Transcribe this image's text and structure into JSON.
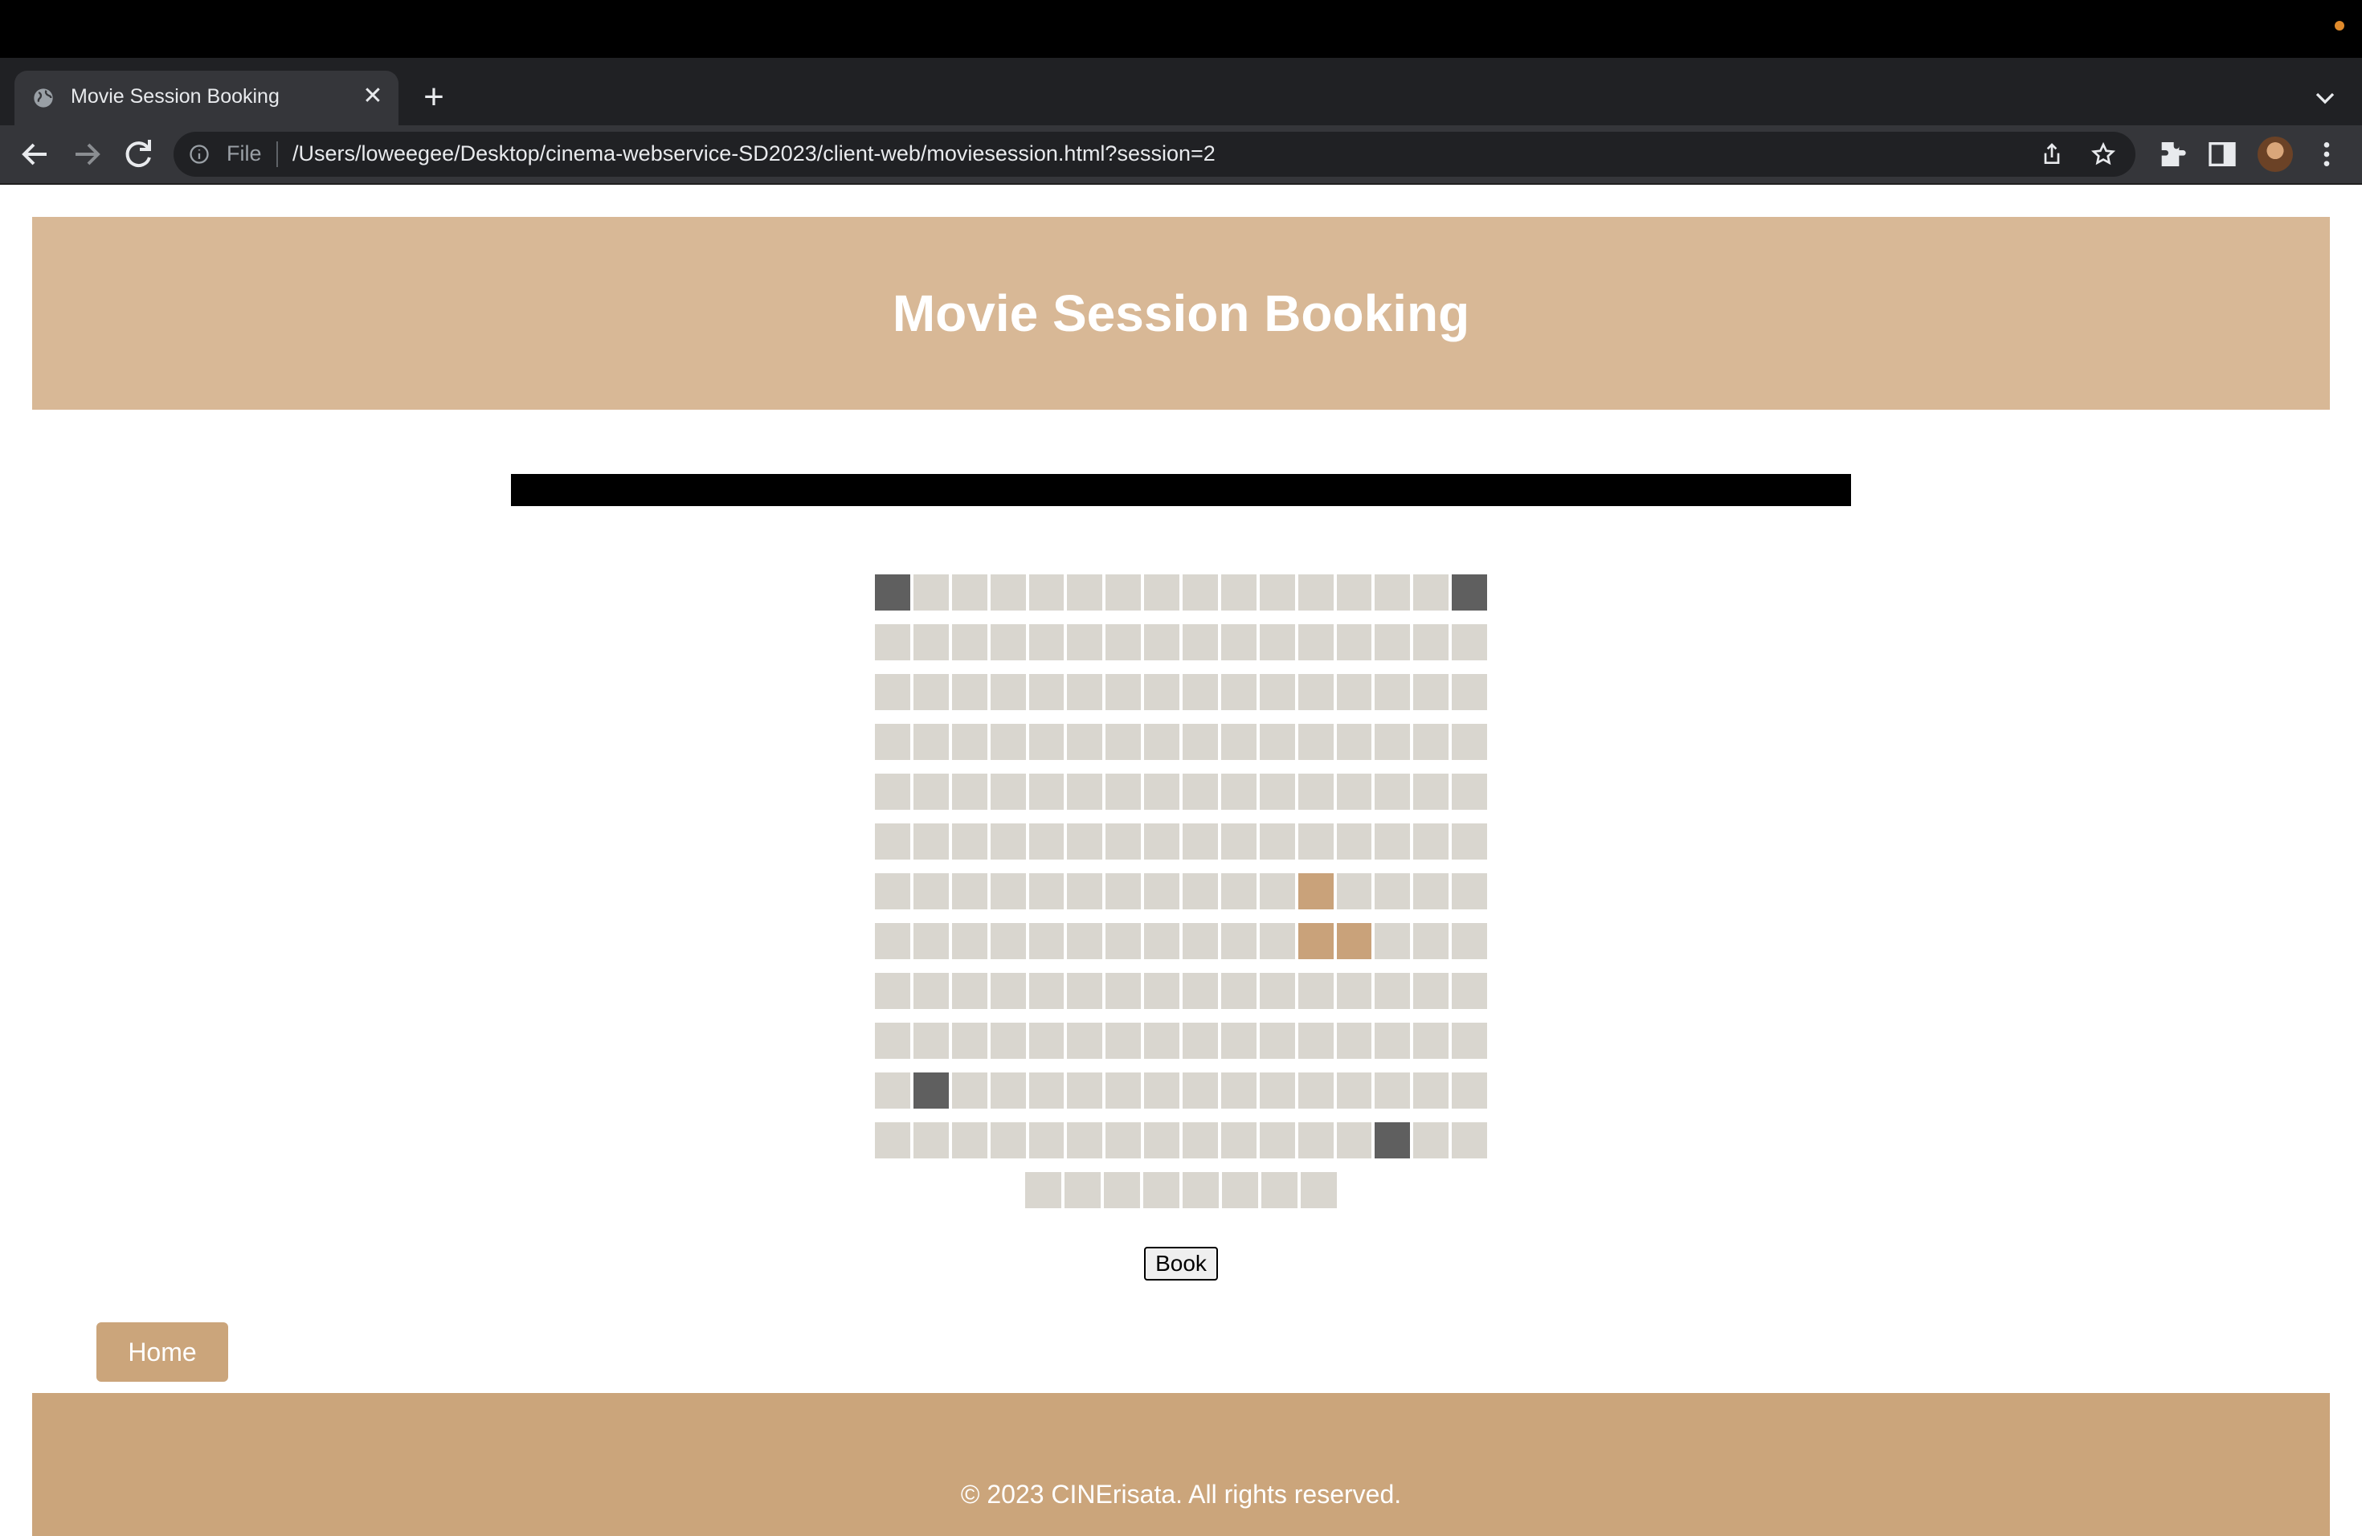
{
  "browser": {
    "tab_title": "Movie Session Booking",
    "tab_close_glyph": "✕",
    "new_tab_glyph": "+",
    "omnibox_file_label": "File",
    "url": "/Users/loweegee/Desktop/cinema-webservice-SD2023/client-web/moviesession.html?session=2",
    "icons": [
      "globe-icon",
      "back-icon",
      "forward-icon",
      "reload-icon",
      "info-icon",
      "share-icon",
      "star-icon",
      "extensions-icon",
      "side-panel-icon",
      "profile-avatar",
      "more-icon",
      "tab-list-icon"
    ]
  },
  "page": {
    "title": "Movie Session Booking",
    "book_label": "Book",
    "home_label": "Home",
    "footer_text": "© 2023 CINErisata. All rights reserved."
  },
  "seating": {
    "rows": [
      [
        "taken",
        "free",
        "free",
        "free",
        "free",
        "free",
        "free",
        "free",
        "free",
        "free",
        "free",
        "free",
        "free",
        "free",
        "free",
        "taken"
      ],
      [
        "free",
        "free",
        "free",
        "free",
        "free",
        "free",
        "free",
        "free",
        "free",
        "free",
        "free",
        "free",
        "free",
        "free",
        "free",
        "free"
      ],
      [
        "free",
        "free",
        "free",
        "free",
        "free",
        "free",
        "free",
        "free",
        "free",
        "free",
        "free",
        "free",
        "free",
        "free",
        "free",
        "free"
      ],
      [
        "free",
        "free",
        "free",
        "free",
        "free",
        "free",
        "free",
        "free",
        "free",
        "free",
        "free",
        "free",
        "free",
        "free",
        "free",
        "free"
      ],
      [
        "free",
        "free",
        "free",
        "free",
        "free",
        "free",
        "free",
        "free",
        "free",
        "free",
        "free",
        "free",
        "free",
        "free",
        "free",
        "free"
      ],
      [
        "free",
        "free",
        "free",
        "free",
        "free",
        "free",
        "free",
        "free",
        "free",
        "free",
        "free",
        "free",
        "free",
        "free",
        "free",
        "free"
      ],
      [
        "free",
        "free",
        "free",
        "free",
        "free",
        "free",
        "free",
        "free",
        "free",
        "free",
        "free",
        "selected",
        "free",
        "free",
        "free",
        "free"
      ],
      [
        "free",
        "free",
        "free",
        "free",
        "free",
        "free",
        "free",
        "free",
        "free",
        "free",
        "free",
        "selected",
        "selected",
        "free",
        "free",
        "free"
      ],
      [
        "free",
        "free",
        "free",
        "free",
        "free",
        "free",
        "free",
        "free",
        "free",
        "free",
        "free",
        "free",
        "free",
        "free",
        "free",
        "free"
      ],
      [
        "free",
        "free",
        "free",
        "free",
        "free",
        "free",
        "free",
        "free",
        "free",
        "free",
        "free",
        "free",
        "free",
        "free",
        "free",
        "free"
      ],
      [
        "free",
        "taken",
        "free",
        "free",
        "free",
        "free",
        "free",
        "free",
        "free",
        "free",
        "free",
        "free",
        "free",
        "free",
        "free",
        "free"
      ],
      [
        "free",
        "free",
        "free",
        "free",
        "free",
        "free",
        "free",
        "free",
        "free",
        "free",
        "free",
        "free",
        "free",
        "taken",
        "free",
        "free"
      ],
      [
        "free",
        "free",
        "free",
        "free",
        "free",
        "free",
        "free",
        "free"
      ]
    ],
    "colors": {
      "free": "#d9d6cf",
      "taken": "#5f5f5f",
      "selected": "#c9a27a",
      "screen": "#000000",
      "header": "#d8b896",
      "footer": "#cba57b"
    }
  }
}
